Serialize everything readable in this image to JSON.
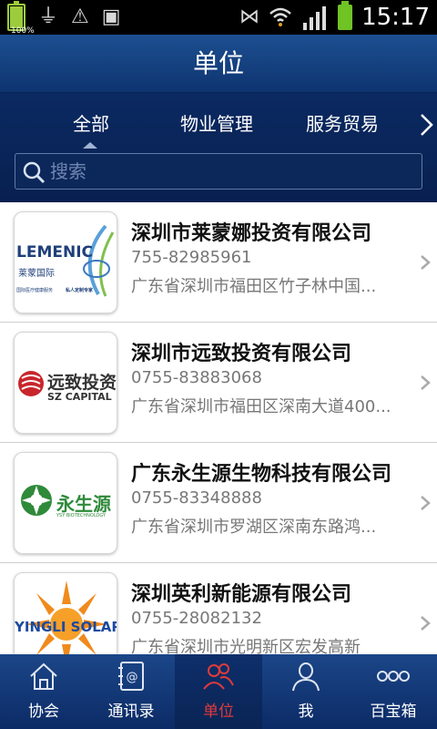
{
  "statusbar": {
    "battery_percent": "100%",
    "time": "15:17"
  },
  "title": "单位",
  "categories": {
    "items": [
      "全部",
      "物业管理",
      "服务贸易"
    ],
    "selected": "全部"
  },
  "search": {
    "placeholder": "搜索"
  },
  "companies": [
    {
      "name": "深圳市莱蒙娜投资有限公司",
      "phone": "755-82985961",
      "address": "广东省深圳市福田区竹子林中国...",
      "logo": {
        "line1": "LEMENIC",
        "line2": "莱蒙国际",
        "line3": "国际医疗健康服务",
        "line4": "私人定制专家"
      }
    },
    {
      "name": "深圳市远致投资有限公司",
      "phone": "0755-83883068",
      "address": "广东省深圳市福田区深南大道400...",
      "logo": {
        "line1": "远致投资",
        "line2": "SZ CAPITAL"
      }
    },
    {
      "name": "广东永生源生物科技有限公司",
      "phone": "0755-83348888",
      "address": "广东省深圳市罗湖区深南东路鸿...",
      "logo": {
        "line1": "永生源",
        "line2": "YSY BIOTECHNOLOGY"
      }
    },
    {
      "name": "深圳英利新能源有限公司",
      "phone": "0755-28082132",
      "address": "广东省深圳市光明新区宏发高新",
      "logo": {
        "line1": "YINGLI SOLAR"
      }
    }
  ],
  "nav": {
    "items": [
      {
        "label": "协会",
        "icon": "home-icon"
      },
      {
        "label": "通讯录",
        "icon": "contacts-book-icon"
      },
      {
        "label": "单位",
        "icon": "group-icon"
      },
      {
        "label": "我",
        "icon": "person-icon"
      },
      {
        "label": "百宝箱",
        "icon": "more-dots-icon"
      }
    ],
    "active": "单位"
  },
  "colors": {
    "header": "#1d4f91",
    "active_nav": "#e23a3a",
    "text_gray": "#777777"
  }
}
